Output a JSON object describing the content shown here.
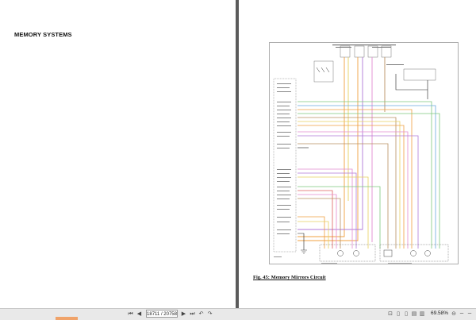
{
  "document": {
    "left_page_heading": "MEMORY SYSTEMS",
    "figure_caption": "Fig. 45: Memory Mirrors Circuit"
  },
  "toolbar": {
    "page_display": "18711 / 20758",
    "zoom_level": "69.58%",
    "icons": [
      "first-page-icon",
      "prev-page-icon",
      "next-page-icon",
      "last-page-icon",
      "back-icon",
      "forward-icon",
      "fit-icon",
      "page-icon",
      "two-page-icon",
      "continuous-icon",
      "single-icon",
      "zoom-out-icon",
      "zoom-in-icon"
    ]
  },
  "colors": {
    "viewer_bg": "#5b5b5b",
    "wire_orange": "#f0a040",
    "wire_green": "#7ec87e",
    "wire_purple": "#b07ad8",
    "wire_pink": "#e48ad0",
    "wire_brown": "#b89060",
    "wire_blue": "#6aa8e0",
    "wire_yellow": "#e8d060",
    "wire_red": "#e06060"
  }
}
